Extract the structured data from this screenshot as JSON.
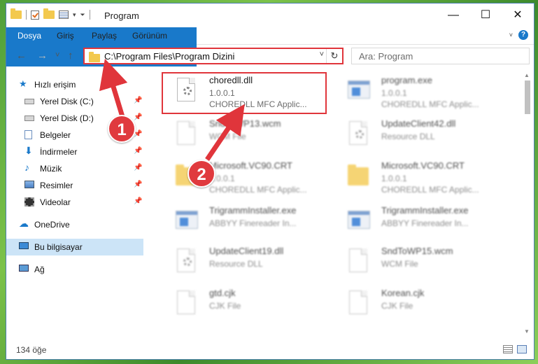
{
  "window": {
    "title": "Program",
    "controls": {
      "minimize": "—",
      "maximize": "☐",
      "close": "✕"
    }
  },
  "ribbon": {
    "tabs": [
      "Dosya",
      "Giriş",
      "Paylaş",
      "Görünüm"
    ]
  },
  "navigation": {
    "back": "←",
    "forward": "→",
    "recent": "˅",
    "up": "↑",
    "address": "C:\\Program Files\\Program Dizini",
    "refresh": "↻",
    "search_placeholder": "Ara: Program"
  },
  "sidebar": {
    "items": [
      {
        "label": "Hızlı erişim",
        "icon": "star-icon",
        "pinned": false
      },
      {
        "label": "Yerel Disk (C:)",
        "icon": "drive-icon",
        "pinned": true
      },
      {
        "label": "Yerel Disk (D:)",
        "icon": "drive-icon",
        "pinned": true
      },
      {
        "label": "Belgeler",
        "icon": "documents-icon",
        "pinned": true
      },
      {
        "label": "İndirmeler",
        "icon": "download-icon",
        "pinned": true
      },
      {
        "label": "Müzik",
        "icon": "music-icon",
        "pinned": true
      },
      {
        "label": "Resimler",
        "icon": "pictures-icon",
        "pinned": true
      },
      {
        "label": "Videolar",
        "icon": "videos-icon",
        "pinned": true
      },
      {
        "label": "OneDrive",
        "icon": "cloud-icon",
        "pinned": false
      },
      {
        "label": "Bu bilgisayar",
        "icon": "computer-icon",
        "pinned": false
      },
      {
        "label": "Ağ",
        "icon": "network-icon",
        "pinned": false
      }
    ]
  },
  "files": [
    {
      "name": "choredll.dll",
      "line2": "1.0.0.1",
      "line3": "CHOREDLL MFC Applic...",
      "icon": "dll-icon"
    },
    {
      "name": "program.exe",
      "line2": "1.0.0.1",
      "line3": "CHOREDLL MFC Applic...",
      "icon": "exe-icon"
    },
    {
      "name": "SndToWP13.wcm",
      "line2": "WCM File",
      "line3": "",
      "icon": "file-icon"
    },
    {
      "name": "UpdateClient42.dll",
      "line2": "Resource DLL",
      "line3": "",
      "icon": "dll-icon"
    },
    {
      "name": "Microsoft.VC90.CRT",
      "line2": "1.0.0.1",
      "line3": "CHOREDLL MFC Applic...",
      "icon": "folder-icon"
    },
    {
      "name": "Microsoft.VC90.CRT",
      "line2": "1.0.0.1",
      "line3": "CHOREDLL MFC Applic...",
      "icon": "folder-icon"
    },
    {
      "name": "TrigrammInstaller.exe",
      "line2": "ABBYY Finereader In...",
      "line3": "",
      "icon": "exe-icon"
    },
    {
      "name": "TrigrammInstaller.exe",
      "line2": "ABBYY Finereader In...",
      "line3": "",
      "icon": "exe-icon"
    },
    {
      "name": "UpdateClient19.dll",
      "line2": "Resource DLL",
      "line3": "",
      "icon": "dll-icon"
    },
    {
      "name": "SndToWP15.wcm",
      "line2": "WCM File",
      "line3": "",
      "icon": "file-icon"
    },
    {
      "name": "gtd.cjk",
      "line2": "CJK File",
      "line3": "",
      "icon": "file-icon"
    },
    {
      "name": "Korean.cjk",
      "line2": "CJK File",
      "line3": "",
      "icon": "file-icon"
    }
  ],
  "annotations": {
    "marker1": "1",
    "marker2": "2",
    "color": "#e0353b"
  },
  "status": {
    "item_count": "134 öğe"
  },
  "colors": {
    "accent": "#1979ca",
    "selection": "#cce4f7",
    "highlight": "#e0353b"
  }
}
